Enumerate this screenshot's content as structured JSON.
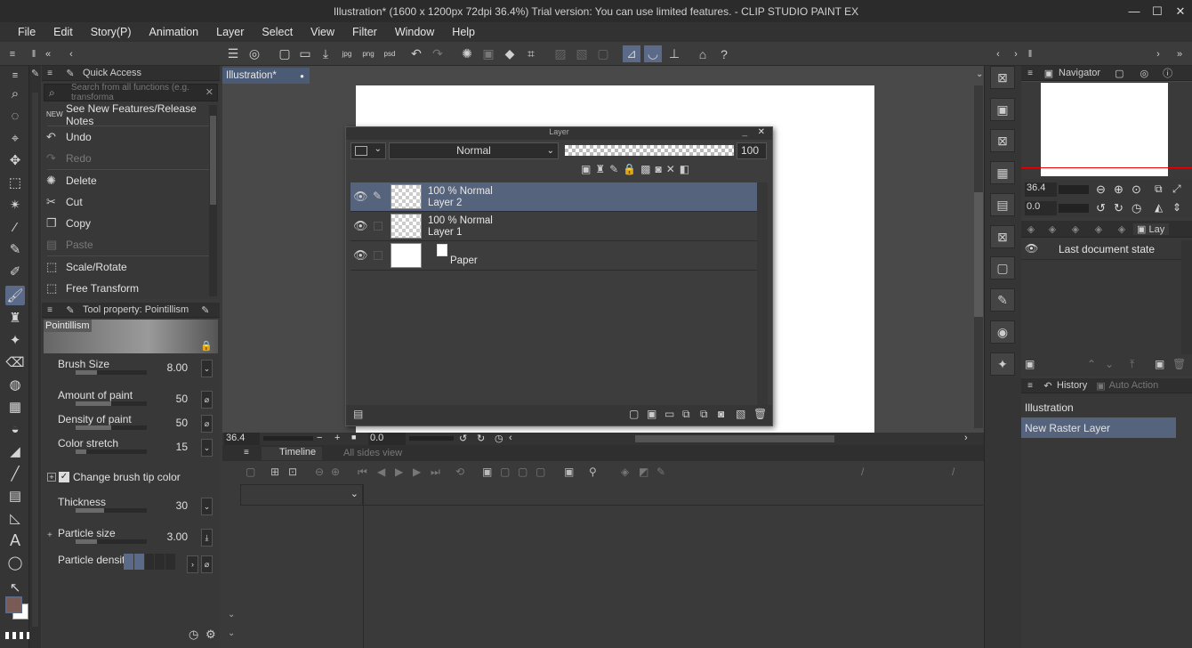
{
  "window": {
    "title": "Illustration* (1600 x 1200px 72dpi 36.4%)  Trial version: You can use limited features. - CLIP STUDIO PAINT EX",
    "minimize": "—",
    "maximize": "☐",
    "close": "✕"
  },
  "menu": [
    "File",
    "Edit",
    "Story(P)",
    "Animation",
    "Layer",
    "Select",
    "View",
    "Filter",
    "Window",
    "Help"
  ],
  "quick_access": {
    "title": "Quick Access",
    "search_placeholder": "Search from all functions (e.g. transforma",
    "items": [
      {
        "label": "See New Features/Release Notes",
        "icon": "new-icon",
        "enabled": true
      },
      {
        "label": "Undo",
        "icon": "undo-icon",
        "enabled": true
      },
      {
        "label": "Redo",
        "icon": "redo-icon",
        "enabled": false
      },
      {
        "label": "Delete",
        "icon": "delete-icon",
        "enabled": true
      },
      {
        "label": "Cut",
        "icon": "scissors-icon",
        "enabled": true
      },
      {
        "label": "Copy",
        "icon": "copy-icon",
        "enabled": true
      },
      {
        "label": "Paste",
        "icon": "paste-icon",
        "enabled": false
      },
      {
        "label": "Scale/Rotate",
        "icon": "scale-icon",
        "enabled": true
      },
      {
        "label": "Free Transform",
        "icon": "transform-icon",
        "enabled": true
      }
    ]
  },
  "tool_property": {
    "title": "Tool property: Pointillism",
    "brush_name": "Pointillism",
    "props": [
      {
        "label": "Brush Size",
        "value": "8.00",
        "fill": 0.3
      },
      {
        "label": "Amount of paint",
        "value": "50",
        "fill": 0.5
      },
      {
        "label": "Density of paint",
        "value": "50",
        "fill": 0.5
      },
      {
        "label": "Color stretch",
        "value": "15",
        "fill": 0.15
      },
      {
        "label": "Thickness",
        "value": "30",
        "fill": 0.4
      },
      {
        "label": "Particle size",
        "value": "3.00",
        "fill": 0.3
      },
      {
        "label": "Particle density",
        "value": "",
        "fill": 0.3
      }
    ],
    "change_brush_tip": "Change brush tip color"
  },
  "document_tab": "Illustration*",
  "canvas_status": {
    "zoom": "36.4",
    "angle": "0.0"
  },
  "layer_window": {
    "title": "Layer",
    "blend_mode": "Normal",
    "opacity": "100",
    "layers": [
      {
        "line1": "100 % Normal",
        "line2": "Layer 2",
        "selected": true
      },
      {
        "line1": "100 % Normal",
        "line2": "Layer 1",
        "selected": false
      },
      {
        "line1": "",
        "line2": "Paper",
        "selected": false
      }
    ]
  },
  "timeline": {
    "tab1": "Timeline",
    "tab2": "All sides view"
  },
  "navigator": {
    "title": "Navigator",
    "zoom": "36.4",
    "angle": "0.0"
  },
  "layer_panel": {
    "tab": "Lay",
    "item": "Last document state"
  },
  "history": {
    "title": "History",
    "tab2": "Auto Action",
    "items": [
      "Illustration",
      "New Raster Layer"
    ]
  }
}
